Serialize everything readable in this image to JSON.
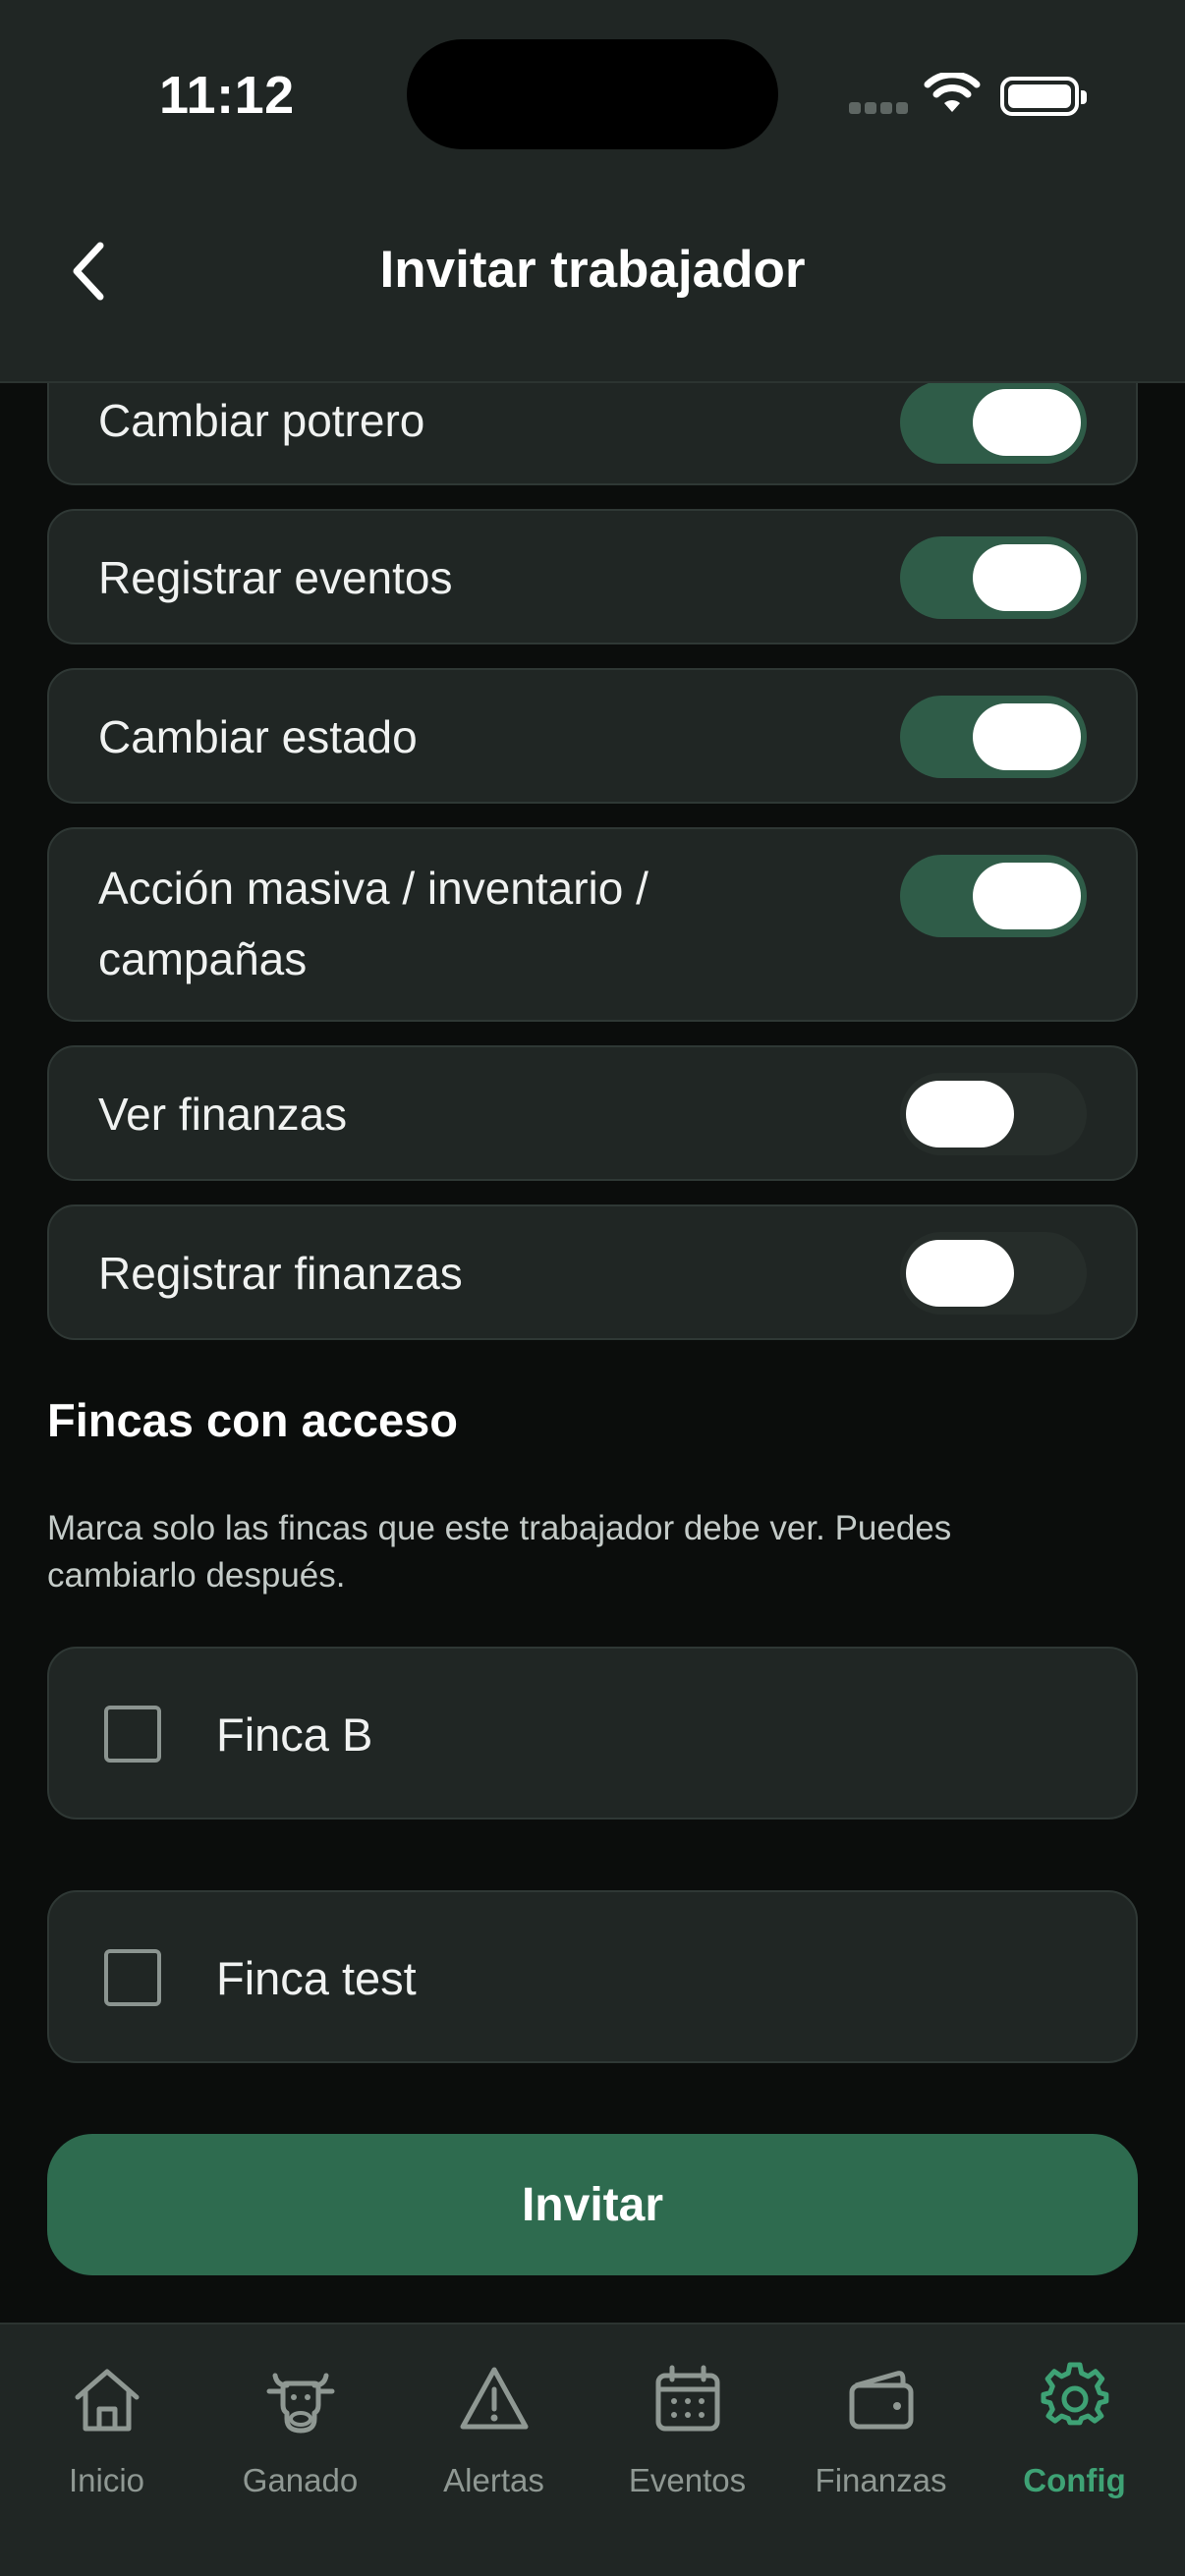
{
  "status_bar": {
    "time": "11:12"
  },
  "header": {
    "title": "Invitar trabajador"
  },
  "permissions": [
    {
      "label": "Cambiar potrero",
      "enabled": true
    },
    {
      "label": "Registrar eventos",
      "enabled": true
    },
    {
      "label": "Cambiar estado",
      "enabled": true
    },
    {
      "label": "Acción masiva / inventario / campañas",
      "enabled": true
    },
    {
      "label": "Ver finanzas",
      "enabled": false
    },
    {
      "label": "Registrar finanzas",
      "enabled": false
    }
  ],
  "farms_section": {
    "title": "Fincas con acceso",
    "description": "Marca solo las fincas que este trabajador debe ver. Puedes cambiarlo después.",
    "farms": [
      {
        "name": "Finca B",
        "checked": false
      },
      {
        "name": "Finca test",
        "checked": false
      }
    ]
  },
  "invite_button": {
    "label": "Invitar"
  },
  "tabbar": {
    "items": [
      {
        "label": "Inicio",
        "icon": "home-icon",
        "active": false
      },
      {
        "label": "Ganado",
        "icon": "cow-icon",
        "active": false
      },
      {
        "label": "Alertas",
        "icon": "warning-icon",
        "active": false
      },
      {
        "label": "Eventos",
        "icon": "calendar-icon",
        "active": false
      },
      {
        "label": "Finanzas",
        "icon": "wallet-icon",
        "active": false
      },
      {
        "label": "Config",
        "icon": "gear-icon",
        "active": true
      }
    ]
  },
  "colors": {
    "accent": "#3ea275",
    "button": "#2e6b4f",
    "toggle_on": "#2f5c48",
    "card": "#202624",
    "background": "#0b0d0c"
  }
}
